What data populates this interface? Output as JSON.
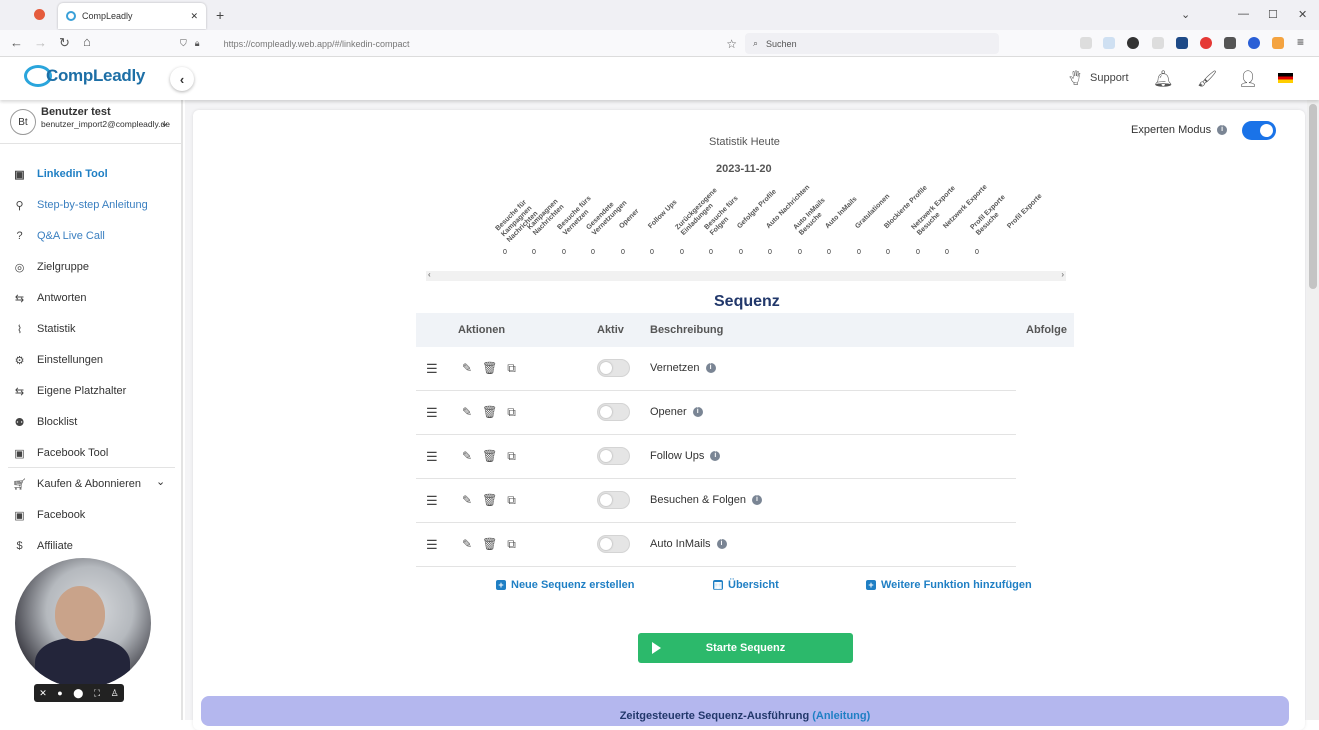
{
  "browser": {
    "tab_title": "CompLeadly",
    "url_host": "https://compleadly.web.app",
    "url_path": "/#/linkedin-compact",
    "search_placeholder": "Suchen"
  },
  "header": {
    "logo_text": "CompLeadly",
    "support_label": "Support"
  },
  "user": {
    "initials": "Bt",
    "name": "Benutzer test",
    "email": "benutzer_import2@compleadly.de"
  },
  "sidebar": {
    "items": [
      {
        "label": "Linkedin Tool",
        "icon": "linkedin-icon"
      },
      {
        "label": "Step-by-step Anleitung",
        "icon": "person-stairs-icon"
      },
      {
        "label": "Q&A Live Call",
        "icon": "question-icon"
      },
      {
        "label": "Zielgruppe",
        "icon": "target-icon"
      },
      {
        "label": "Antworten",
        "icon": "reply-icon"
      },
      {
        "label": "Statistik",
        "icon": "chart-icon"
      },
      {
        "label": "Einstellungen",
        "icon": "gear-icon"
      },
      {
        "label": "Eigene Platzhalter",
        "icon": "placeholder-icon"
      },
      {
        "label": "Blocklist",
        "icon": "users-block-icon"
      },
      {
        "label": "Facebook Tool",
        "icon": "facebook-icon"
      },
      {
        "label": "Kaufen & Abonnieren",
        "icon": "cart-icon"
      },
      {
        "label": "Facebook",
        "icon": "facebook-icon"
      },
      {
        "label": "Affiliate",
        "icon": "dollar-icon"
      }
    ]
  },
  "stats": {
    "title": "Statistik Heute",
    "date": "2023-11-20",
    "columns": [
      {
        "label": "Besuche für\nKampagnen\nNachrichten",
        "value": "0"
      },
      {
        "label": "Kampagnen\nNachrichten",
        "value": "0"
      },
      {
        "label": "Besuche fürs\nVernetzen",
        "value": "0"
      },
      {
        "label": "Gesendete\nVernetzungen",
        "value": "0"
      },
      {
        "label": "Opener",
        "value": "0"
      },
      {
        "label": "Follow Ups",
        "value": "0"
      },
      {
        "label": "Zurückgezogene\nEinladungen",
        "value": "0"
      },
      {
        "label": "Besuche fürs\nFolgen",
        "value": "0"
      },
      {
        "label": "Gefolgte Profile",
        "value": "0"
      },
      {
        "label": "Auto Nachrichten",
        "value": "0"
      },
      {
        "label": "Auto InMails\nBesuche",
        "value": "0"
      },
      {
        "label": "Auto InMails",
        "value": "0"
      },
      {
        "label": "Gratulationen",
        "value": "0"
      },
      {
        "label": "Blockierte Profile",
        "value": "0"
      },
      {
        "label": "Netzwerk Exporte\nBesuche",
        "value": "0"
      },
      {
        "label": "Netzwerk Exporte",
        "value": "0"
      },
      {
        "label": "Profil Exporte\nBesuche",
        "value": "0"
      },
      {
        "label": "Profil Exporte",
        "value": ""
      }
    ]
  },
  "expert_mode": {
    "label": "Experten Modus",
    "enabled": true
  },
  "sequence": {
    "title": "Sequenz",
    "headers": {
      "actions": "Aktionen",
      "active": "Aktiv",
      "description": "Beschreibung",
      "order": "Abfolge"
    },
    "rows": [
      {
        "description": "Vernetzen",
        "active": false
      },
      {
        "description": "Opener",
        "active": false
      },
      {
        "description": "Follow Ups",
        "active": false
      },
      {
        "description": "Besuchen & Folgen",
        "active": false
      },
      {
        "description": "Auto InMails",
        "active": false
      }
    ],
    "new_sequence": "Neue Sequenz erstellen",
    "overview": "Übersicht",
    "add_function": "Weitere Funktion hinzufügen",
    "start_button": "Starte Sequenz"
  },
  "scheduled": {
    "text": "Zeitgesteuerte Sequenz-Ausführung",
    "link": "(Anleitung)"
  },
  "colors": {
    "accent": "#1f7fc4",
    "start": "#2cb96b",
    "toggle_on": "#1a73e8",
    "banner": "#b4b7ee"
  }
}
